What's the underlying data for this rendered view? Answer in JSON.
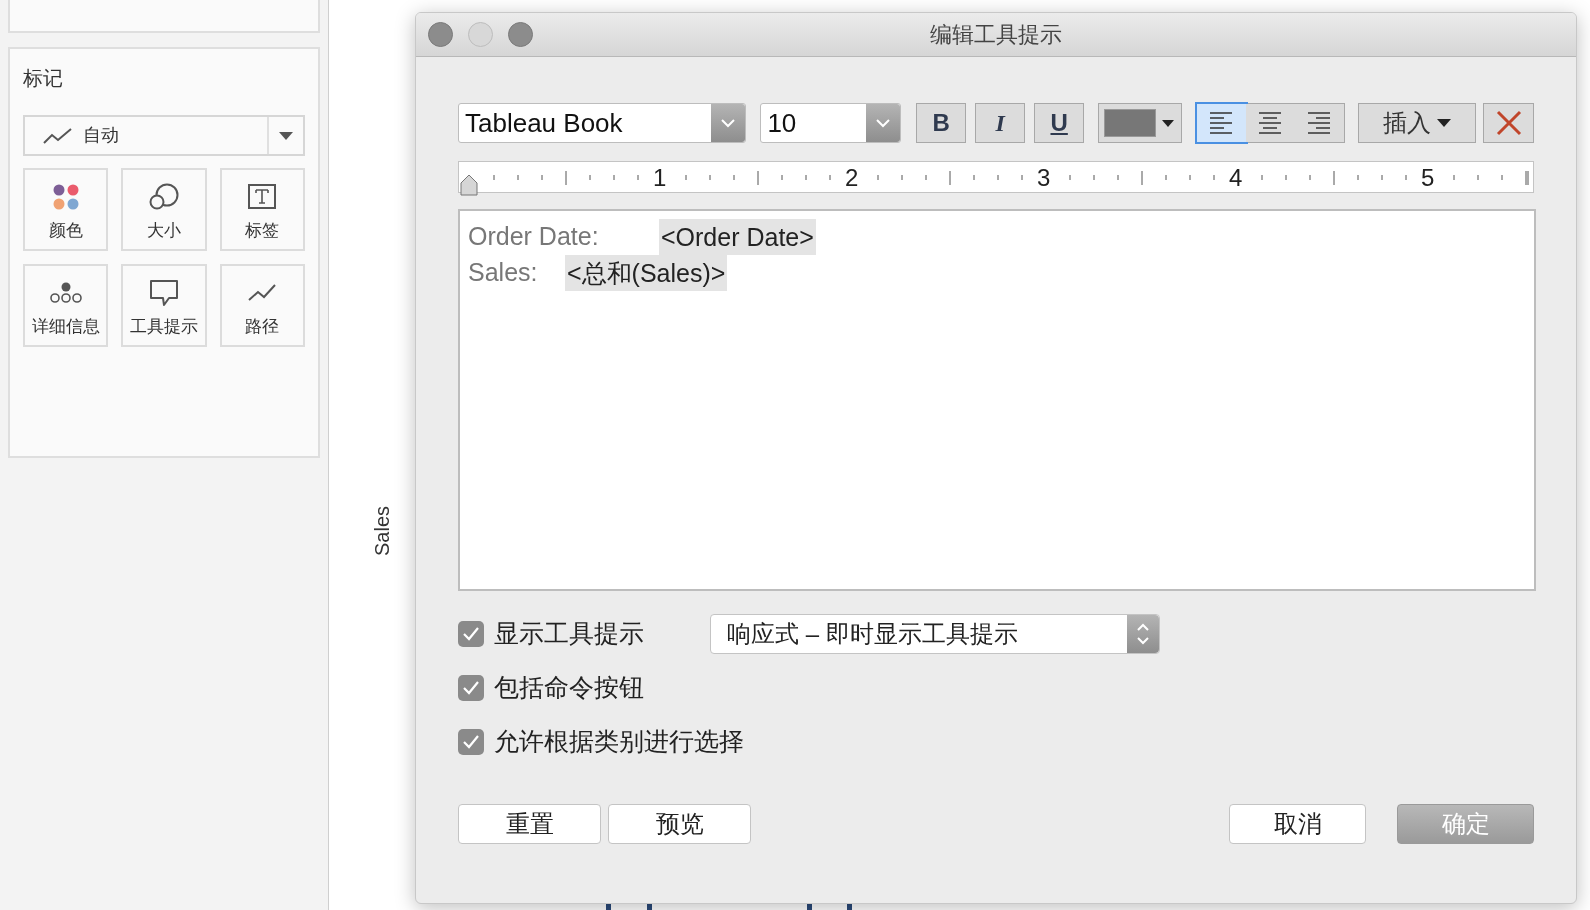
{
  "sidebar": {
    "marks_title": "标记",
    "mark_type": {
      "label": "自动"
    },
    "cards": [
      {
        "label": "颜色",
        "kind": "color"
      },
      {
        "label": "大小",
        "kind": "size"
      },
      {
        "label": "标签",
        "kind": "label"
      },
      {
        "label": "详细信息",
        "kind": "detail"
      },
      {
        "label": "工具提示",
        "kind": "tooltip"
      },
      {
        "label": "路径",
        "kind": "path"
      }
    ]
  },
  "chart": {
    "axis_title": "Sales"
  },
  "dialog": {
    "title": "编辑工具提示",
    "font": {
      "value": "Tableau Book"
    },
    "size": {
      "value": "10"
    },
    "format_buttons": [
      {
        "label": "B",
        "kind": "bold"
      },
      {
        "label": "I",
        "kind": "italic"
      },
      {
        "label": "U",
        "kind": "underline"
      }
    ],
    "alignment": [
      {
        "kind": "left",
        "selected": true
      },
      {
        "kind": "center",
        "selected": false
      },
      {
        "kind": "right",
        "selected": false
      }
    ],
    "insert_button": "插入",
    "ruler_labels": [
      "1",
      "2",
      "3",
      "4",
      "5"
    ],
    "lines": [
      {
        "label": "Order Date:",
        "field": "<Order Date>"
      },
      {
        "label": "Sales:",
        "field": "<总和(Sales)>"
      }
    ],
    "options": [
      {
        "label": "显示工具提示",
        "checked": true
      },
      {
        "label": "包括命令按钮",
        "checked": true
      },
      {
        "label": "允许根据类别进行选择",
        "checked": true
      }
    ],
    "mode_select": {
      "value": "响应式 – 即时显示工具提示"
    },
    "buttons": [
      {
        "label": "重置",
        "kind": "normal"
      },
      {
        "label": "预览",
        "kind": "normal"
      },
      {
        "label": "取消",
        "kind": "normal"
      },
      {
        "label": "确定",
        "kind": "default"
      }
    ]
  }
}
